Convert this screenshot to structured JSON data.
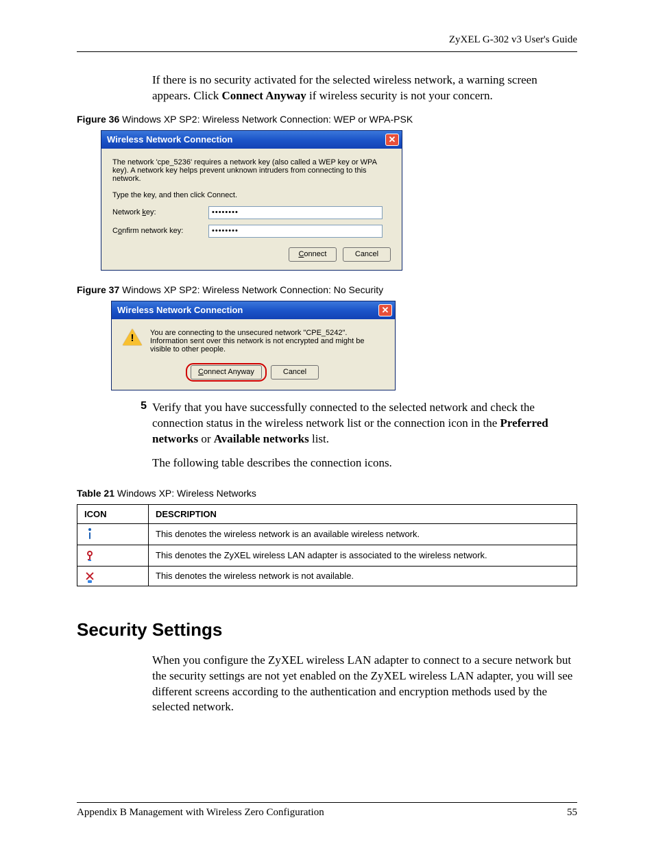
{
  "header": {
    "guide": "ZyXEL G-302 v3 User's Guide"
  },
  "intro": {
    "p1a": "If there is no security activated for the selected wireless network, a warning screen appears. Click ",
    "p1b": "Connect Anyway",
    "p1c": " if wireless security is not your concern."
  },
  "fig36": {
    "label": "Figure 36",
    "caption": "   Windows XP SP2: Wireless Network Connection: WEP or WPA-PSK",
    "title": "Wireless Network Connection",
    "desc": "The network 'cpe_5236' requires a network key (also called a WEP key or WPA key). A network key helps prevent unknown intruders from connecting to this network.",
    "instr": "Type the key, and then click Connect.",
    "lbl_key_pre": "Network ",
    "lbl_key_u": "k",
    "lbl_key_post": "ey:",
    "lbl_conf_pre": "C",
    "lbl_conf_u": "o",
    "lbl_conf_post": "nfirm network key:",
    "val_key": "••••••••",
    "val_conf": "••••••••",
    "btn_connect_u": "C",
    "btn_connect_post": "onnect",
    "btn_cancel": "Cancel"
  },
  "fig37": {
    "label": "Figure 37",
    "caption": "   Windows XP SP2: Wireless Network Connection: No Security",
    "title": "Wireless Network Connection",
    "desc": "You are connecting to the unsecured network \"CPE_5242\". Information sent over this network is not encrypted and might be visible to other people.",
    "btn_anyway_u": "C",
    "btn_anyway_post": "onnect Anyway",
    "btn_cancel": "Cancel"
  },
  "step5": {
    "num": "5",
    "t1": "Verify that you have successfully connected to the selected network and check the connection status in the wireless network list or the connection icon in the ",
    "b1": "Preferred networks",
    "t2": " or ",
    "b2": "Available networks",
    "t3": " list.",
    "p2": "The following table describes the connection icons."
  },
  "table21": {
    "label": "Table 21",
    "caption": "   Windows XP: Wireless Networks",
    "h_icon": "ICON",
    "h_desc": "DESCRIPTION",
    "r1": "This denotes the wireless network is an available wireless network.",
    "r2": "This denotes the ZyXEL wireless LAN adapter is associated to the wireless network.",
    "r3": "This denotes the wireless network is not available."
  },
  "sec": {
    "title": "Security Settings",
    "p": "When you configure the ZyXEL wireless LAN adapter to connect to a secure network but the security settings are not yet enabled on the ZyXEL wireless LAN adapter, you will see different screens according to the authentication and encryption methods used by the selected network."
  },
  "footer": {
    "left": "Appendix B Management with Wireless Zero Configuration",
    "right": "55"
  }
}
